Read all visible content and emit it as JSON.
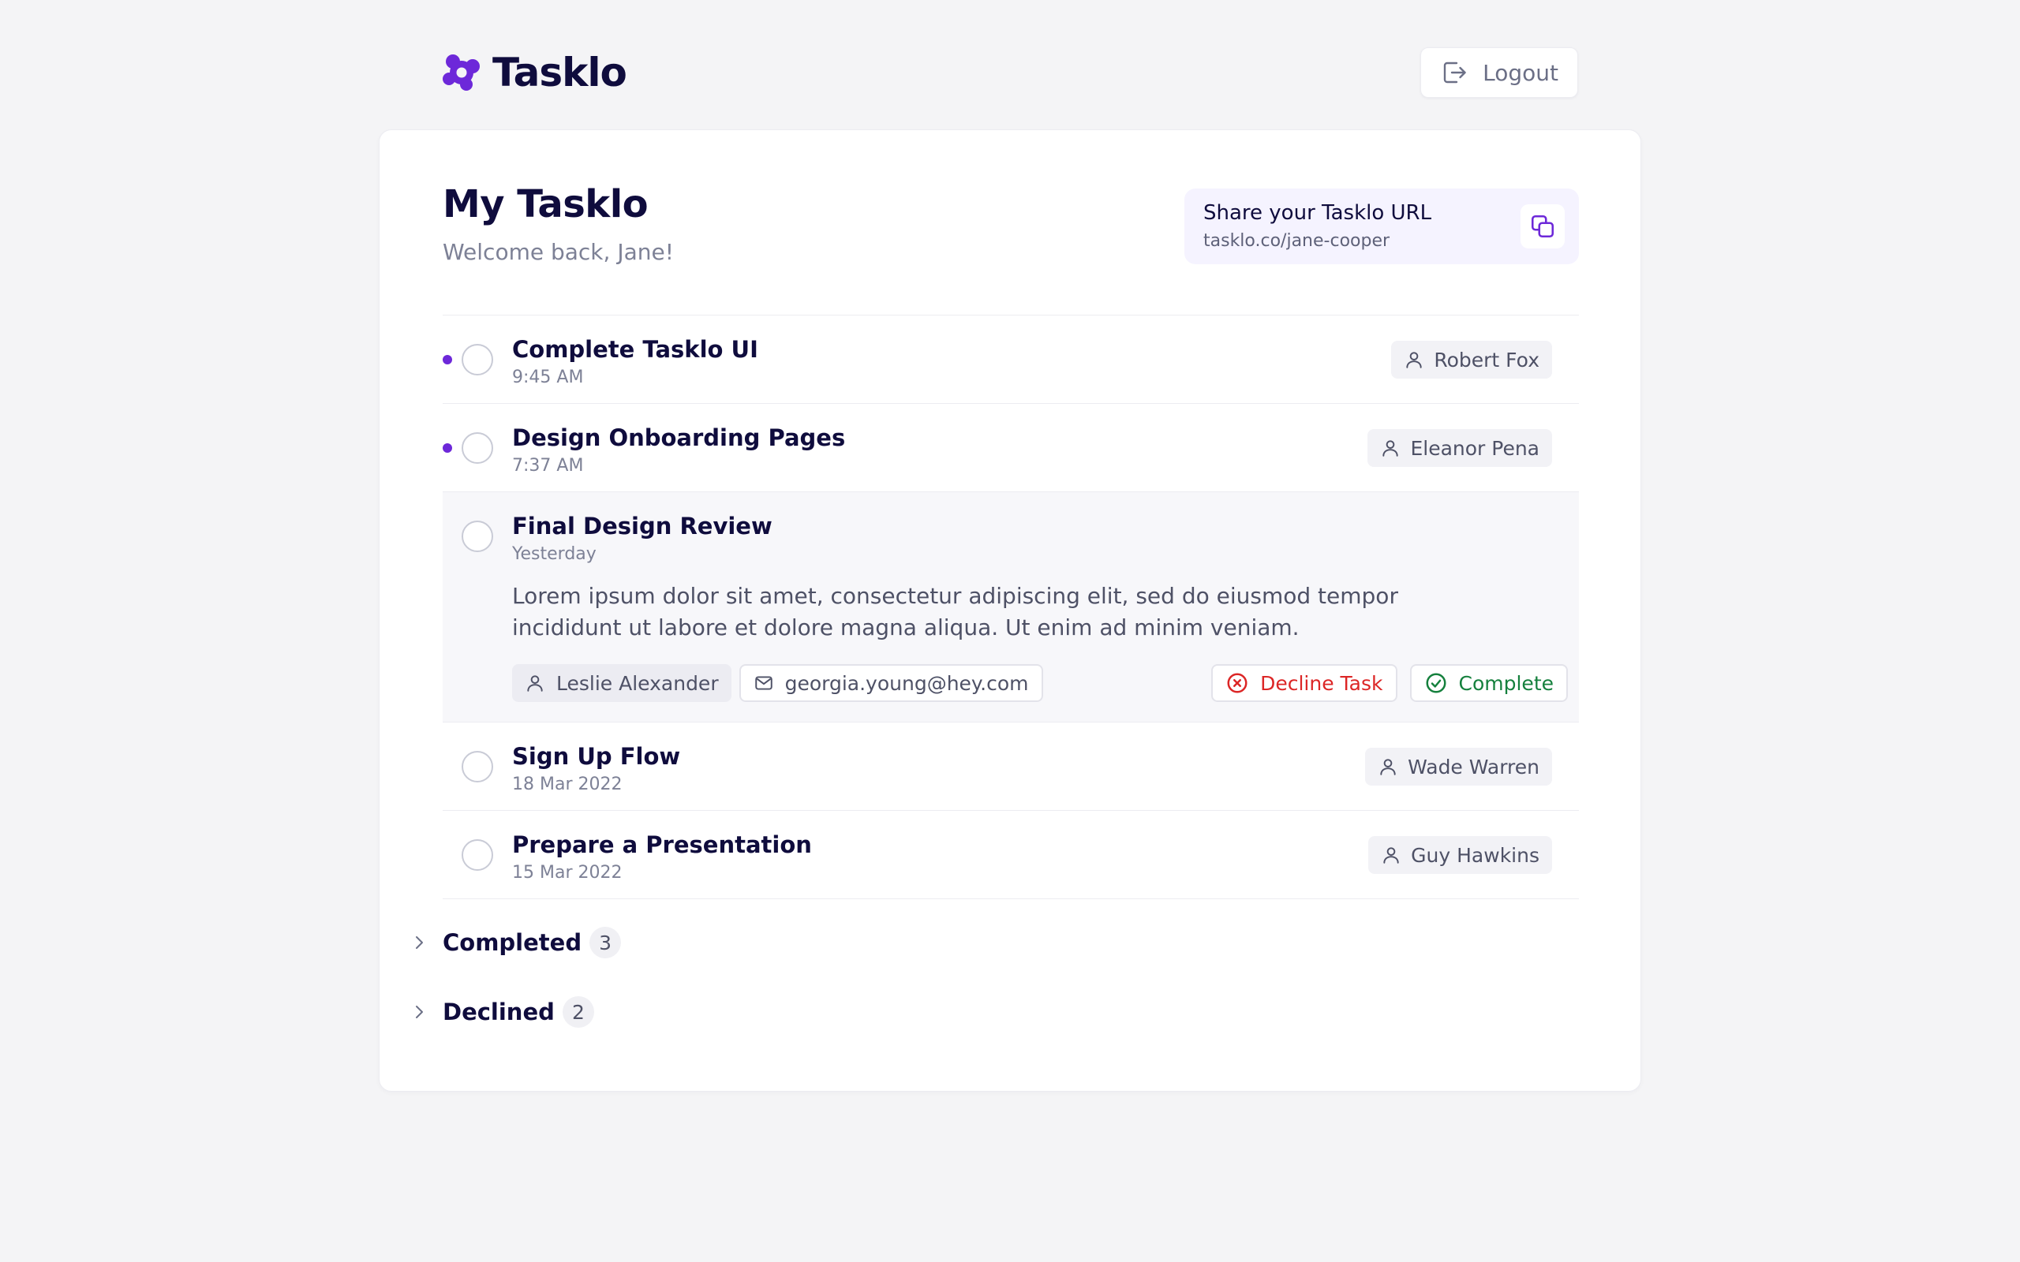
{
  "app": {
    "brand": "Tasklo",
    "logout_label": "Logout",
    "accent_color": "#6d28d9"
  },
  "page": {
    "title": "My Tasklo",
    "subtitle": "Welcome back, Jane!"
  },
  "share": {
    "title": "Share your Tasklo URL",
    "url": "tasklo.co/jane-cooper"
  },
  "tasks": [
    {
      "name": "Complete Tasklo UI",
      "time": "9:45 AM",
      "assignee": "Robert Fox",
      "unread": true
    },
    {
      "name": "Design Onboarding Pages",
      "time": "7:37 AM",
      "assignee": "Eleanor Pena",
      "unread": true
    },
    {
      "name": "Final Design Review",
      "time": "Yesterday",
      "expanded": true,
      "description": "Lorem ipsum dolor sit amet, consectetur adipiscing elit, sed do eiusmod tempor incididunt ut labore et dolore magna aliqua. Ut enim ad minim veniam.",
      "requester": "Leslie Alexander",
      "email": "georgia.young@hey.com",
      "decline_label": "Decline Task",
      "complete_label": "Complete"
    },
    {
      "name": "Sign Up Flow",
      "time": "18 Mar 2022",
      "assignee": "Wade Warren",
      "unread": false
    },
    {
      "name": "Prepare a Presentation",
      "time": "15 Mar 2022",
      "assignee": "Guy Hawkins",
      "unread": false
    }
  ],
  "groups": {
    "completed": {
      "label": "Completed",
      "count": "3"
    },
    "declined": {
      "label": "Declined",
      "count": "2"
    }
  }
}
